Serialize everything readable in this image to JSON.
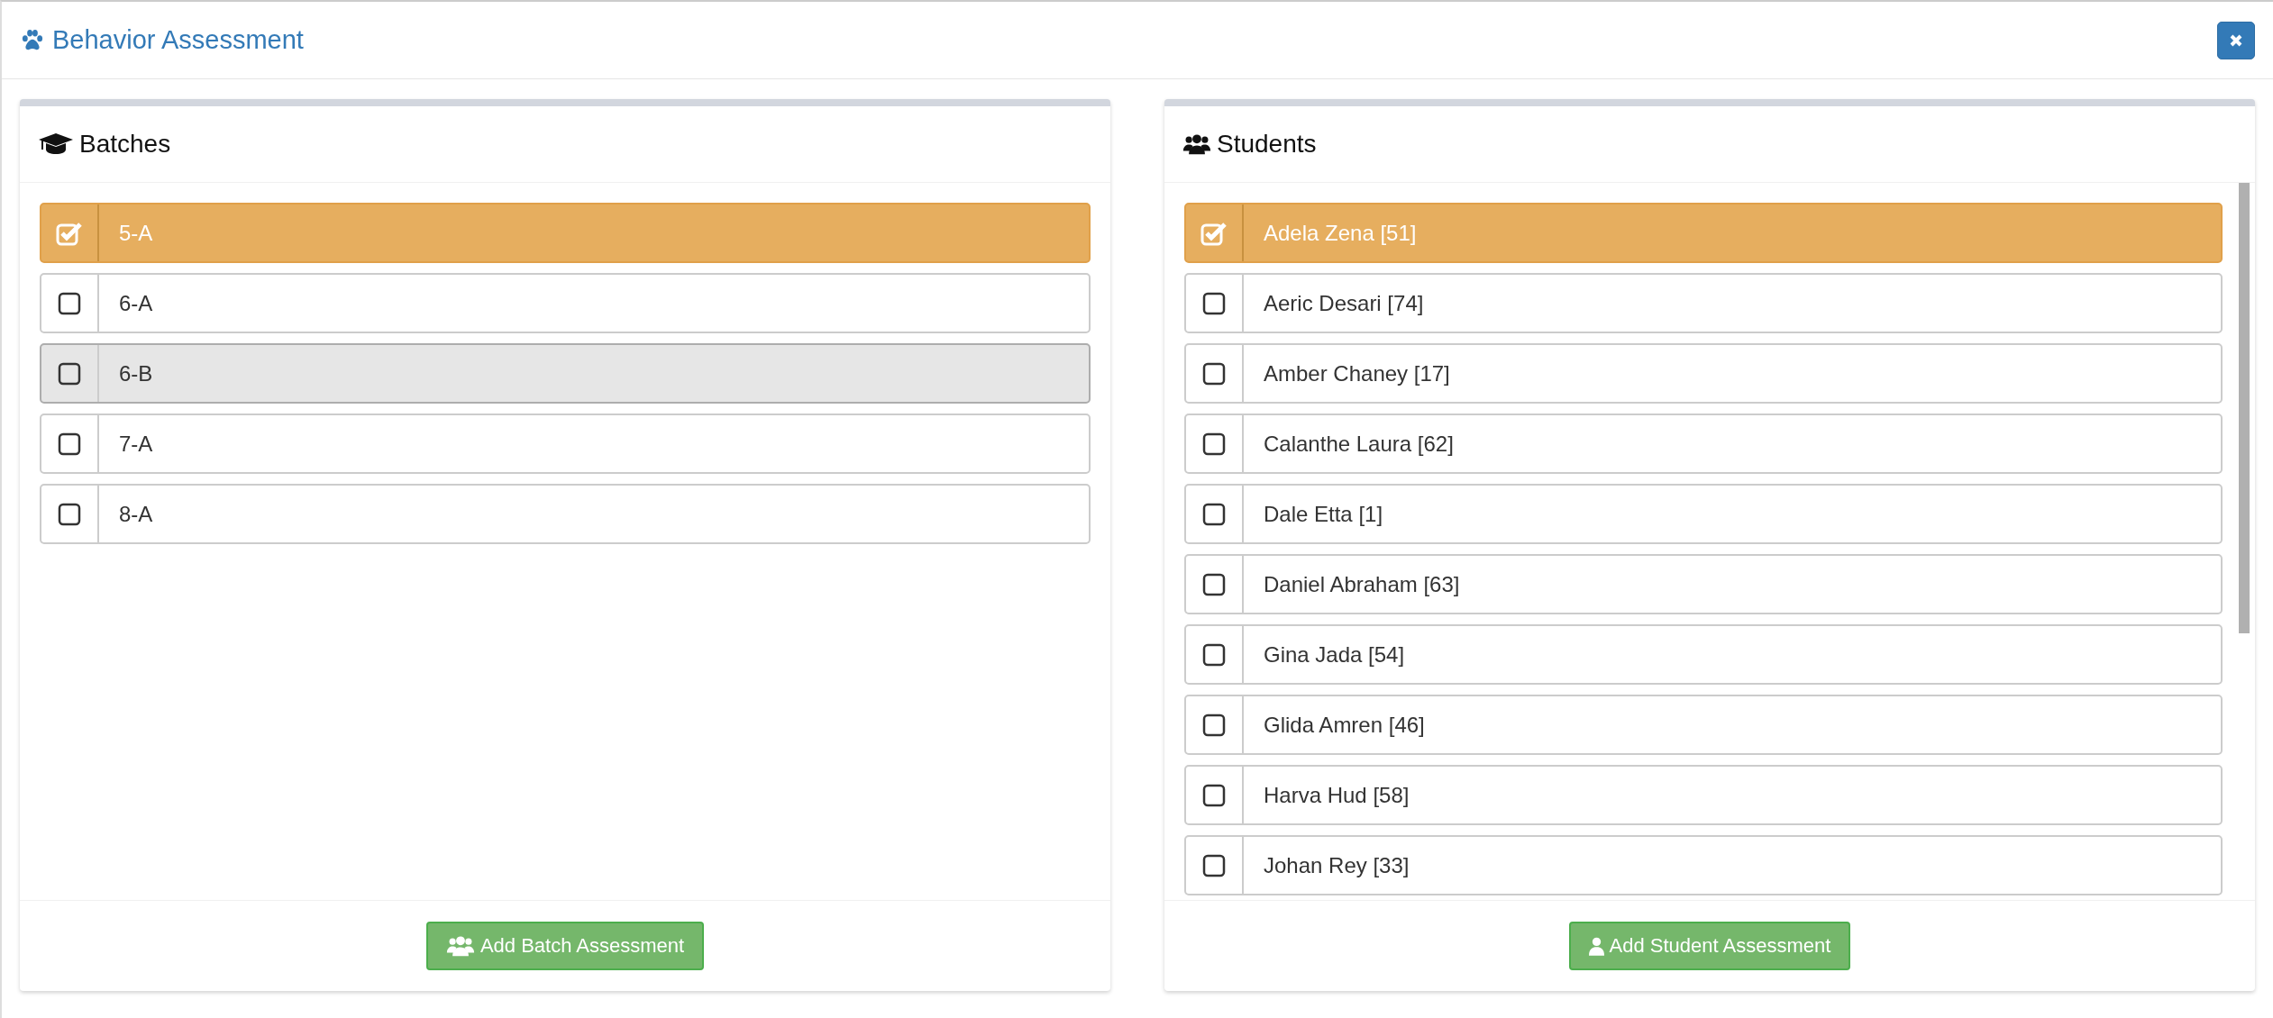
{
  "window": {
    "title": "Behavior Assessment"
  },
  "panels": [
    {
      "kind": "batches",
      "title": "Batches",
      "scrollbar": false,
      "items": [
        {
          "label": "5-A",
          "checked": true,
          "hovered": false
        },
        {
          "label": "6-A",
          "checked": false,
          "hovered": false
        },
        {
          "label": "6-B",
          "checked": false,
          "hovered": true
        },
        {
          "label": "7-A",
          "checked": false,
          "hovered": false
        },
        {
          "label": "8-A",
          "checked": false,
          "hovered": false
        }
      ],
      "button": {
        "kind": "group",
        "label": "Add Batch Assessment"
      }
    },
    {
      "kind": "students",
      "title": "Students",
      "scrollbar": true,
      "items": [
        {
          "label": "Adela Zena [51]",
          "checked": true,
          "hovered": false
        },
        {
          "label": "Aeric Desari [74]",
          "checked": false,
          "hovered": false
        },
        {
          "label": "Amber Chaney [17]",
          "checked": false,
          "hovered": false
        },
        {
          "label": "Calanthe Laura [62]",
          "checked": false,
          "hovered": false
        },
        {
          "label": "Dale Etta [1]",
          "checked": false,
          "hovered": false
        },
        {
          "label": "Daniel Abraham [63]",
          "checked": false,
          "hovered": false
        },
        {
          "label": "Gina Jada [54]",
          "checked": false,
          "hovered": false
        },
        {
          "label": "Glida Amren [46]",
          "checked": false,
          "hovered": false
        },
        {
          "label": "Harva Hud [58]",
          "checked": false,
          "hovered": false
        },
        {
          "label": "Johan Rey [33]",
          "checked": false,
          "hovered": false
        }
      ],
      "button": {
        "kind": "user",
        "label": "Add Student Assessment"
      }
    }
  ]
}
